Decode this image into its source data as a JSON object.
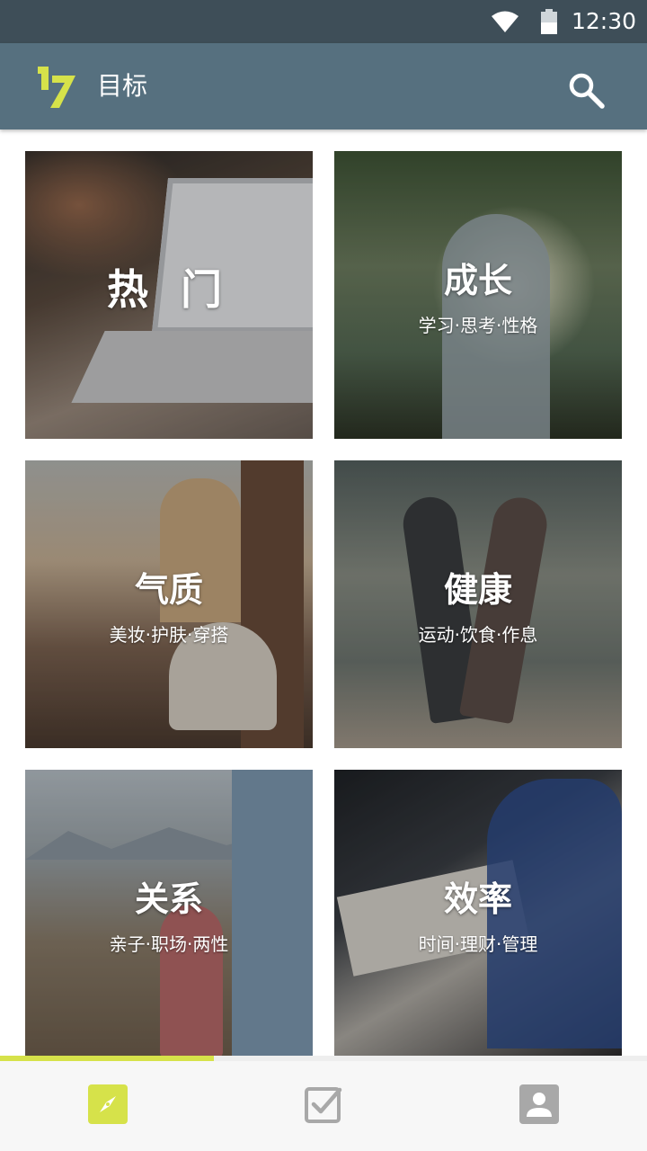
{
  "status_bar": {
    "time": "12:30",
    "icons": [
      "wifi-icon",
      "battery-icon"
    ]
  },
  "app_bar": {
    "title": "目标",
    "logo": "17-logo",
    "logo_color": "#d6e24a",
    "search_icon": "search-icon"
  },
  "categories": [
    {
      "title": "热 门",
      "subtitle": ""
    },
    {
      "title": "成长",
      "subtitle": "学习·思考·性格"
    },
    {
      "title": "气质",
      "subtitle": "美妆·护肤·穿搭"
    },
    {
      "title": "健康",
      "subtitle": "运动·饮食·作息"
    },
    {
      "title": "关系",
      "subtitle": "亲子·职场·两性"
    },
    {
      "title": "效率",
      "subtitle": "时间·理财·管理"
    }
  ],
  "scroll_progress": 0.33,
  "bottom_nav": {
    "tabs": [
      {
        "icon": "compass-icon",
        "active": true
      },
      {
        "icon": "checkbox-icon",
        "active": false
      },
      {
        "icon": "profile-icon",
        "active": false
      }
    ],
    "accent_color": "#d6e24a"
  }
}
